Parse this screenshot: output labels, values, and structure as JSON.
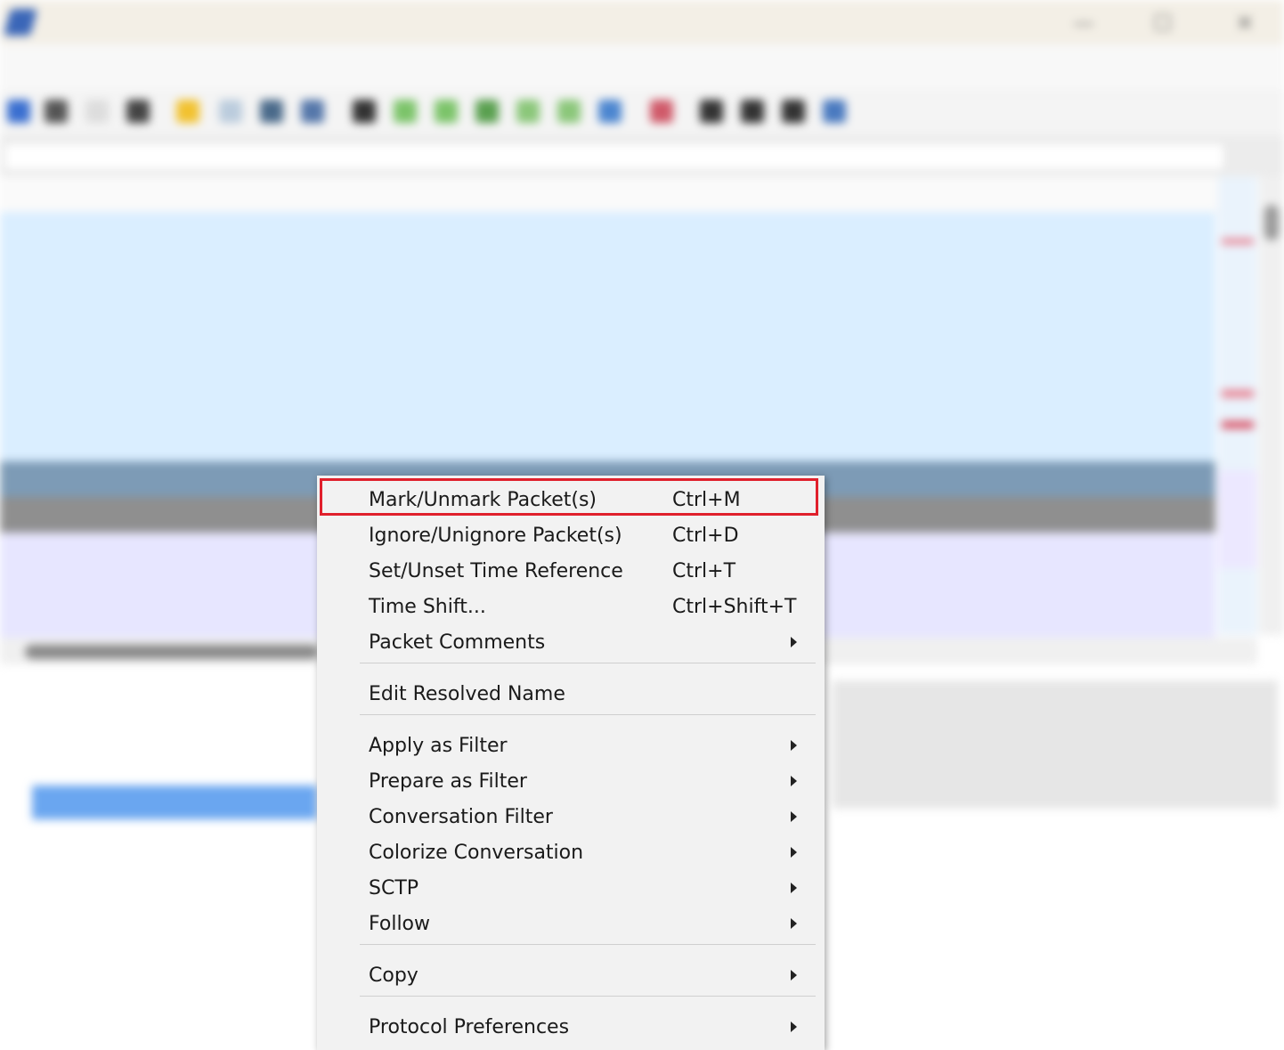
{
  "context_menu": {
    "items": [
      {
        "label": "Mark/Unmark Packet(s)",
        "shortcut": "Ctrl+M",
        "submenu": false,
        "highlighted": true
      },
      {
        "label": "Ignore/Unignore Packet(s)",
        "shortcut": "Ctrl+D",
        "submenu": false
      },
      {
        "label": "Set/Unset Time Reference",
        "shortcut": "Ctrl+T",
        "submenu": false
      },
      {
        "label": "Time Shift...",
        "shortcut": "Ctrl+Shift+T",
        "submenu": false
      },
      {
        "label": "Packet Comments",
        "shortcut": "",
        "submenu": true
      },
      {
        "label": "Edit Resolved Name",
        "shortcut": "",
        "submenu": false
      },
      {
        "label": "Apply as Filter",
        "shortcut": "",
        "submenu": true
      },
      {
        "label": "Prepare as Filter",
        "shortcut": "",
        "submenu": true
      },
      {
        "label": "Conversation Filter",
        "shortcut": "",
        "submenu": true
      },
      {
        "label": "Colorize Conversation",
        "shortcut": "",
        "submenu": true
      },
      {
        "label": "SCTP",
        "shortcut": "",
        "submenu": true
      },
      {
        "label": "Follow",
        "shortcut": "",
        "submenu": true
      },
      {
        "label": "Copy",
        "shortcut": "",
        "submenu": true
      },
      {
        "label": "Protocol Preferences",
        "shortcut": "",
        "submenu": true
      }
    ],
    "highlight_color": "#e0202c"
  },
  "colors": {
    "udp_row": "#daeeff",
    "tcp_row": "#e7e6ff",
    "selected_row": "#7d9bb6",
    "gray_row": "#8f8f8f",
    "detail_selected": "#6aa6f0"
  }
}
